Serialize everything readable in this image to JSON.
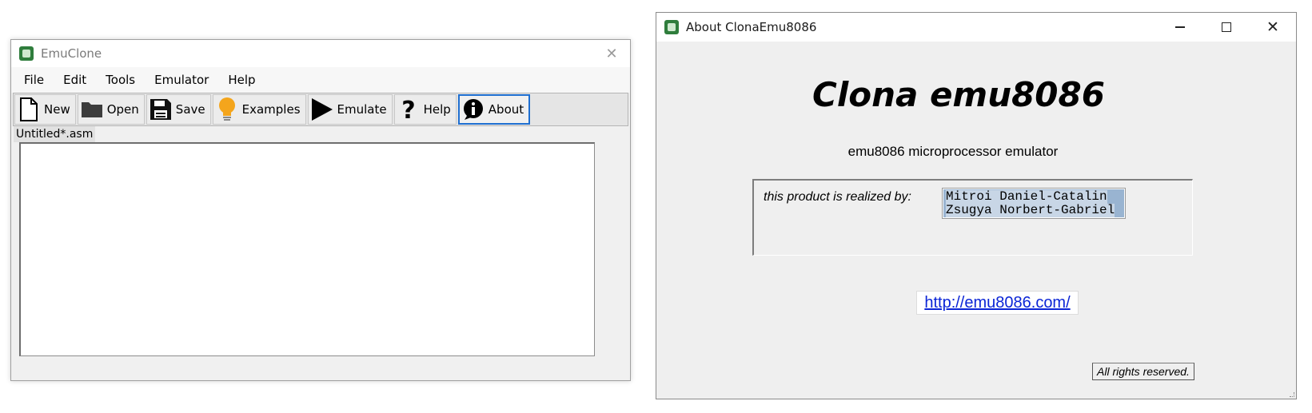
{
  "main_window": {
    "title": "EmuClone",
    "menu": [
      "File",
      "Edit",
      "Tools",
      "Emulator",
      "Help"
    ],
    "toolbar": [
      {
        "label": "New",
        "icon": "new-file-icon"
      },
      {
        "label": "Open",
        "icon": "folder-icon"
      },
      {
        "label": "Save",
        "icon": "floppy-disk-icon"
      },
      {
        "label": "Examples",
        "icon": "lightbulb-icon"
      },
      {
        "label": "Emulate",
        "icon": "play-icon"
      },
      {
        "label": "Help",
        "icon": "question-mark-icon"
      },
      {
        "label": "About",
        "icon": "info-bubble-icon"
      }
    ],
    "active_toolbar_button": "About",
    "editor_tab": "Untitled*.asm"
  },
  "about_window": {
    "title": "About ClonaEmu8086",
    "heading": "Clona emu8086",
    "subtitle": "emu8086 microprocessor emulator",
    "credits_label": "this product is realized by:",
    "credits": [
      "Mitroi Daniel-Catalin",
      "Zsugya Norbert-Gabriel"
    ],
    "link": "http://emu8086.com/",
    "rights": "All rights reserved."
  },
  "colors": {
    "accent": "#1f6fd1",
    "link": "#0b25d6",
    "selection": "#99b4d1"
  }
}
